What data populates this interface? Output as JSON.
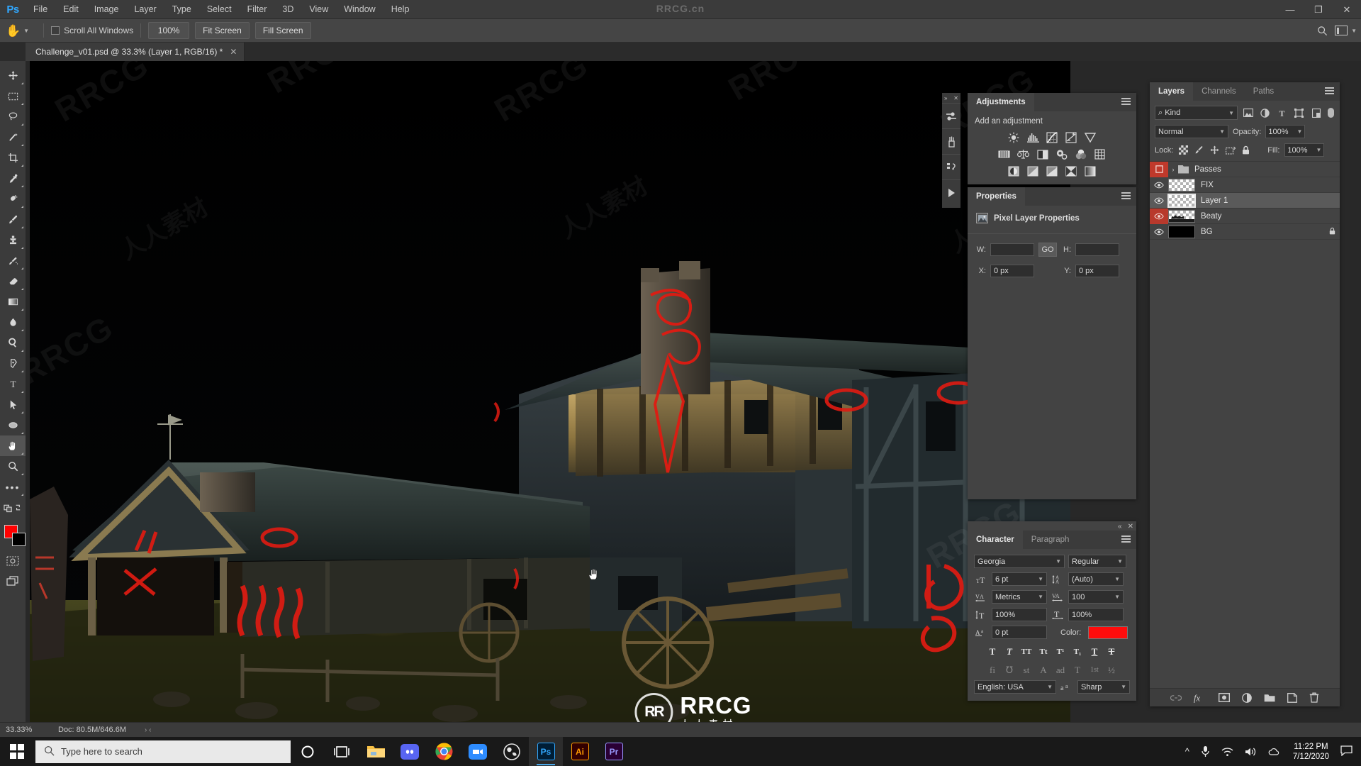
{
  "app": {
    "name": "Adobe Photoshop",
    "logo_text": "Ps",
    "watermark_top": "RRCG.cn"
  },
  "menubar": {
    "items": [
      "File",
      "Edit",
      "Image",
      "Layer",
      "Type",
      "Select",
      "Filter",
      "3D",
      "View",
      "Window",
      "Help"
    ],
    "window_controls": {
      "minimize": "—",
      "maximize": "❐",
      "close": "✕"
    }
  },
  "options_bar": {
    "tool_icon": "hand-tool-icon",
    "scroll_all_windows_label": "Scroll All Windows",
    "buttons": [
      "100%",
      "Fit Screen",
      "Fill Screen"
    ],
    "right_icons": [
      "search-icon",
      "workspace-switcher-icon"
    ]
  },
  "document_tab": {
    "title": "Challenge_v01.psd @ 33.3% (Layer 1, RGB/16) *",
    "close_label": "✕"
  },
  "toolbar": {
    "tools": [
      {
        "name": "move-tool",
        "glyph": "✥"
      },
      {
        "name": "rectangular-marquee-tool",
        "glyph": "▢"
      },
      {
        "name": "lasso-tool",
        "glyph": "◯"
      },
      {
        "name": "magic-wand-tool",
        "glyph": "✦"
      },
      {
        "name": "crop-tool",
        "glyph": "⊐"
      },
      {
        "name": "eyedropper-tool",
        "glyph": "⚲"
      },
      {
        "name": "spot-healing-brush-tool",
        "glyph": "✎"
      },
      {
        "name": "brush-tool",
        "glyph": "🖌"
      },
      {
        "name": "clone-stamp-tool",
        "glyph": "⬒"
      },
      {
        "name": "history-brush-tool",
        "glyph": "⌁"
      },
      {
        "name": "eraser-tool",
        "glyph": "◧"
      },
      {
        "name": "gradient-tool",
        "glyph": "▭"
      },
      {
        "name": "blur-tool",
        "glyph": "💧"
      },
      {
        "name": "dodge-tool",
        "glyph": "◉"
      },
      {
        "name": "pen-tool",
        "glyph": "✒"
      },
      {
        "name": "type-tool",
        "glyph": "T"
      },
      {
        "name": "path-selection-tool",
        "glyph": "➤"
      },
      {
        "name": "ellipse-tool",
        "glyph": "⬭"
      },
      {
        "name": "hand-tool",
        "glyph": "✋"
      },
      {
        "name": "zoom-tool",
        "glyph": "🔍"
      },
      {
        "name": "edit-toolbar-tool",
        "glyph": "•••"
      }
    ],
    "colors": {
      "foreground": "#ff0000",
      "background": "#000000"
    }
  },
  "adjustments_panel": {
    "tab_label": "Adjustments",
    "section_title": "Add an adjustment",
    "icons": [
      "brightness-contrast-icon",
      "levels-icon",
      "curves-icon",
      "exposure-icon",
      "vibrance-icon",
      "hue-saturation-icon",
      "color-balance-icon",
      "black-white-icon",
      "photo-filter-icon",
      "channel-mixer-icon",
      "color-lookup-icon",
      "invert-icon",
      "posterize-icon",
      "threshold-icon",
      "selective-color-icon",
      "gradient-map-icon"
    ]
  },
  "icon_dock": {
    "items": [
      "adjustments-dock-icon",
      "brush-settings-dock-icon",
      "history-dock-icon",
      "actions-dock-icon"
    ],
    "collapse_label": "»",
    "close_label": "✕"
  },
  "properties_panel": {
    "tab_label": "Properties",
    "header": "Pixel Layer Properties",
    "fields": {
      "w_label": "W:",
      "w_value": "",
      "h_label": "H:",
      "h_value": "",
      "x_label": "X:",
      "x_value": "0 px",
      "y_label": "Y:",
      "y_value": "0 px",
      "link_label": "GO"
    }
  },
  "character_panel": {
    "tabs": [
      "Character",
      "Paragraph"
    ],
    "active_tab": "Character",
    "font_family": "Georgia",
    "font_style": "Regular",
    "font_size": "6 pt",
    "leading": "(Auto)",
    "kerning": "Metrics",
    "tracking": "100",
    "vertical_scale": "100%",
    "horizontal_scale": "100%",
    "baseline_shift": "0 pt",
    "color_label": "Color:",
    "color_value": "#ff0c0c",
    "style_buttons": [
      "T",
      "T",
      "TT",
      "Tt",
      "T¹",
      "T₁",
      "T",
      "T"
    ],
    "ot_buttons": [
      "fi",
      "℧",
      "st",
      "A",
      "ad",
      "T",
      "1st",
      "½"
    ],
    "language": "English: USA",
    "anti_alias": "Sharp",
    "collapse_label": "«",
    "close_label": "✕"
  },
  "layers_panel": {
    "tabs": [
      "Layers",
      "Channels",
      "Paths"
    ],
    "active_tab": "Layers",
    "filter_kind": "Kind",
    "filter_icons": [
      "pixel-filter-icon",
      "adjustment-filter-icon",
      "type-filter-icon",
      "shape-filter-icon",
      "smart-object-filter-icon"
    ],
    "blend_mode": "Normal",
    "opacity_label": "Opacity:",
    "opacity_value": "100%",
    "lock_label": "Lock:",
    "lock_icons": [
      "lock-transparent-pixels-icon",
      "lock-image-pixels-icon",
      "lock-position-icon",
      "lock-artboard-icon",
      "lock-all-icon"
    ],
    "fill_label": "Fill:",
    "fill_value": "100%",
    "layers": [
      {
        "name": "Passes",
        "type": "group",
        "visible": false,
        "selected": false,
        "locked": false,
        "eye_highlight": true
      },
      {
        "name": "FIX",
        "type": "pixel",
        "visible": true,
        "selected": false,
        "locked": false,
        "eye_highlight": false
      },
      {
        "name": "Layer 1",
        "type": "pixel",
        "visible": true,
        "selected": true,
        "locked": false,
        "eye_highlight": false
      },
      {
        "name": "Beaty",
        "type": "pixel",
        "visible": true,
        "selected": false,
        "locked": false,
        "eye_highlight": true
      },
      {
        "name": "BG",
        "type": "pixel",
        "visible": true,
        "selected": false,
        "locked": true,
        "eye_highlight": false
      }
    ],
    "footer_icons": [
      "link-layers-icon",
      "layer-style-fx-icon",
      "layer-mask-icon",
      "new-fill-adjustment-icon",
      "new-group-icon",
      "new-layer-icon",
      "delete-layer-icon"
    ]
  },
  "status_bar": {
    "zoom": "33.33%",
    "doc_info": "Doc: 80.5M/646.6M",
    "arrows": "› ‹"
  },
  "canvas": {
    "watermark_text": "RRCG",
    "watermark_cn": "人人素材",
    "big_watermark": {
      "mark": "RR",
      "text": "RRCG",
      "sub": "人人素材"
    },
    "cursor": "hand-cursor"
  },
  "taskbar": {
    "search_placeholder": "Type here to search",
    "apps": [
      {
        "name": "cortana-icon",
        "label": "◯"
      },
      {
        "name": "task-view-icon",
        "label": "❏"
      },
      {
        "name": "file-explorer-icon",
        "label": ""
      },
      {
        "name": "discord-icon",
        "label": ""
      },
      {
        "name": "chrome-icon",
        "label": ""
      },
      {
        "name": "zoom-icon",
        "label": ""
      },
      {
        "name": "obs-icon",
        "label": ""
      },
      {
        "name": "photoshop-icon",
        "label": "Ps"
      },
      {
        "name": "illustrator-icon",
        "label": "Ai"
      },
      {
        "name": "premiere-icon",
        "label": "Pr"
      }
    ],
    "tray": [
      "show-hidden-icons",
      "microphone-icon",
      "wifi-icon",
      "volume-icon",
      "onedrive-icon"
    ],
    "time": "11:22 PM",
    "date": "7/12/2020",
    "notification": "notification-icon"
  }
}
